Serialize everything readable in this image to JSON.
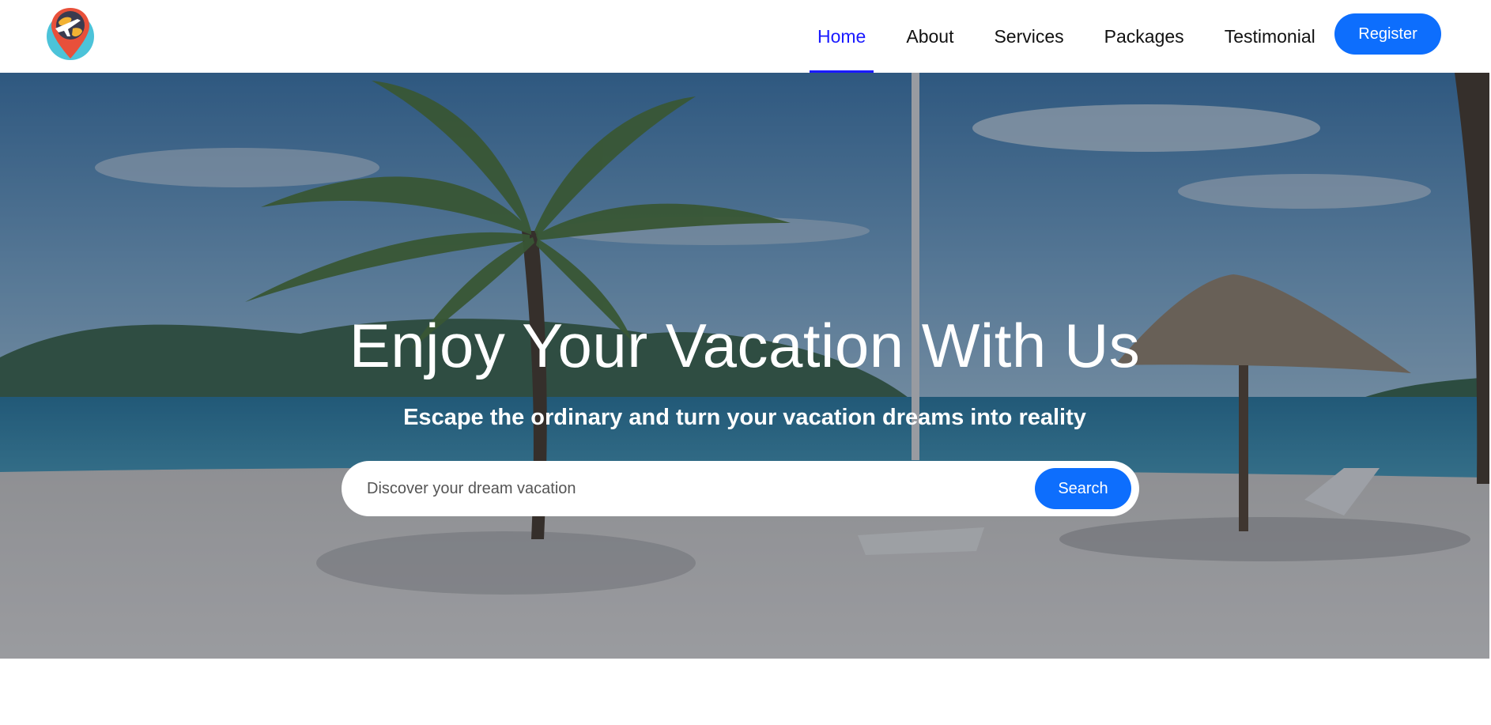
{
  "brand": {
    "logo_icon": "globe-pin-plane-icon"
  },
  "nav": {
    "items": [
      {
        "label": "Home",
        "active": true
      },
      {
        "label": "About",
        "active": false
      },
      {
        "label": "Services",
        "active": false
      },
      {
        "label": "Packages",
        "active": false
      },
      {
        "label": "Testimonial",
        "active": false
      }
    ],
    "register_label": "Register"
  },
  "hero": {
    "title": "Enjoy Your Vacation With Us",
    "subtitle": "Escape the ordinary and turn your vacation dreams into reality",
    "search": {
      "placeholder": "Discover your dream vacation",
      "button_label": "Search"
    }
  },
  "colors": {
    "accent": "#0d6efd",
    "active_link": "#1a1aff"
  }
}
